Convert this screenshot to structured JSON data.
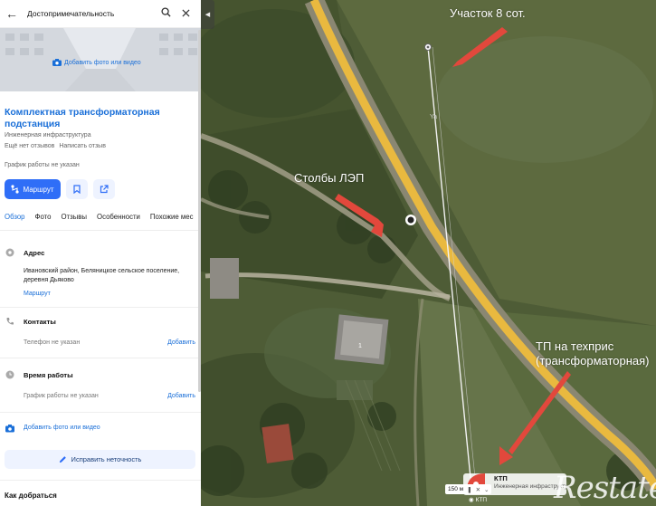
{
  "search": {
    "query": "Достопримечательность"
  },
  "place": {
    "add_photo": "Добавить фото или видео",
    "title": "Комплектная трансформаторная подстанция",
    "category": "Инженерная инфраструктура",
    "reviews": "Ещё нет отзывов",
    "write_review": "Написать отзыв",
    "hours_unknown": "График работы не указан",
    "route_button": "Маршрут"
  },
  "tabs": [
    "Обзор",
    "Фото",
    "Отзывы",
    "Особенности",
    "Похожие мес"
  ],
  "address": {
    "label": "Адрес",
    "value": "Ивановский район, Беляницкое сельское поселение, деревня Дьяково",
    "route_link": "Маршрут"
  },
  "contacts": {
    "label": "Контакты",
    "value": "Телефон не указан",
    "add": "Добавить"
  },
  "working_hours": {
    "label": "Время работы",
    "value": "График работы не указан",
    "add": "Добавить"
  },
  "add_media": "Добавить фото или видео",
  "fix_button": "Исправить неточность",
  "how_to_get": "Как добраться",
  "map": {
    "annotations": {
      "plot": "Участок 8 сот.",
      "poles": "Столбы ЛЭП",
      "tp_line1": "ТП на техприс",
      "tp_line2": "(трансформаторная)"
    },
    "ktp_name": "КТП",
    "ktp_category": "Инженерная инфраструкту",
    "scale": "150 м",
    "ktp_small": "КТП",
    "road_label": "Ya",
    "house_number": "1",
    "watermark": "Restate"
  },
  "colors": {
    "accent": "#1a6fd8",
    "button": "#2f6ef7",
    "arrow": "#e2483c",
    "road": "#e9b93f"
  }
}
